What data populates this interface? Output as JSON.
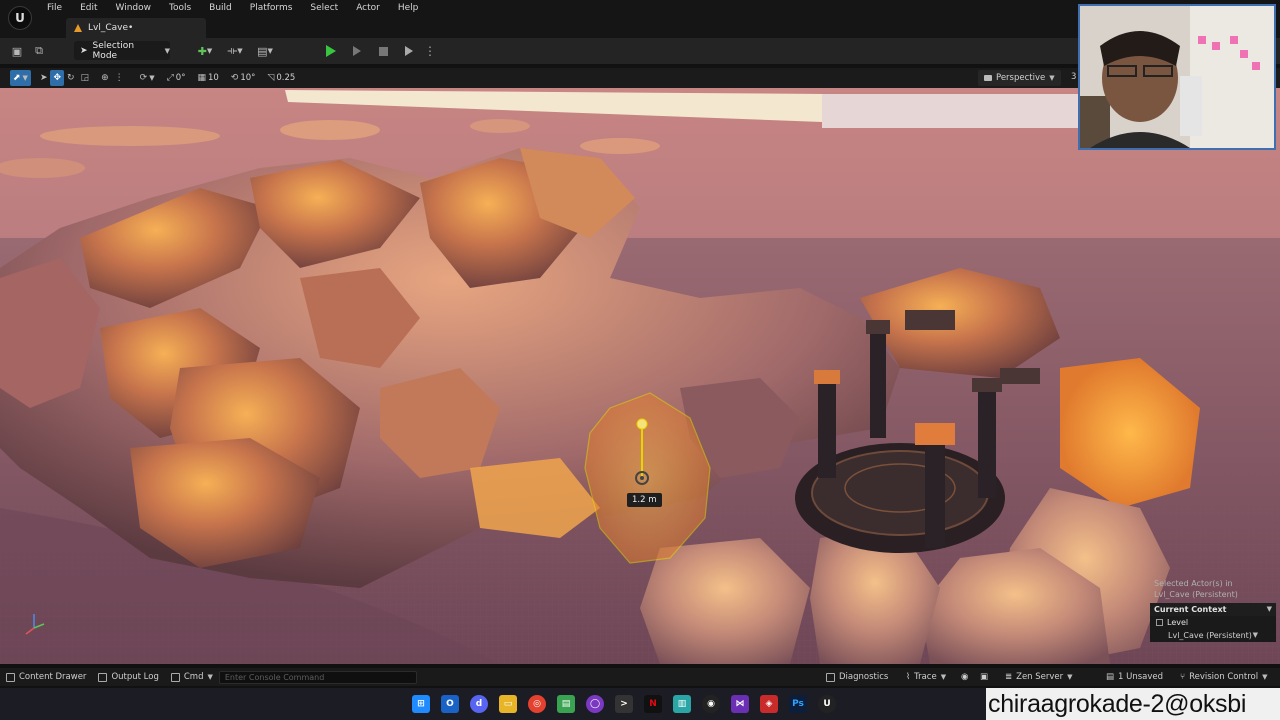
{
  "menu": {
    "items": [
      "File",
      "Edit",
      "Window",
      "Tools",
      "Build",
      "Platforms",
      "Select",
      "Actor",
      "Help"
    ]
  },
  "tab": {
    "label": "Lvl_Cave•"
  },
  "toolbar": {
    "selection_mode": "Selection Mode"
  },
  "viewport_toolbar": {
    "rot_snap": "0°",
    "grid_snap": "10",
    "angle_snap": "10°",
    "scale_snap": "0.25",
    "view_mode": "Perspective",
    "overflow": "3"
  },
  "viewport": {
    "measure_label": "1.2 m"
  },
  "selection_panel": {
    "line1": "Selected Actor(s) in",
    "line2": "Lvl_Cave (Persistent)",
    "context_header": "Current Context",
    "level_label": "Level",
    "level_value": "Lvl_Cave (Persistent)"
  },
  "statusbar": {
    "content_drawer": "Content Drawer",
    "output_log": "Output Log",
    "cmd": "Cmd",
    "console_placeholder": "Enter Console Command",
    "diagnostics": "Diagnostics",
    "trace": "Trace",
    "zen_server": "Zen Server",
    "unsaved": "1 Unsaved",
    "revision_control": "Revision Control"
  },
  "taskbar": {
    "apps": [
      "windows-start",
      "outlook",
      "discord",
      "file-explorer",
      "chrome",
      "notepad",
      "github",
      "terminal",
      "netflix",
      "files",
      "obs",
      "vscode",
      "davinci",
      "photoshop",
      "unreal"
    ]
  },
  "watermark": {
    "text": "chiraagrokade-2@oksbi"
  },
  "colors": {
    "accent_blue": "#2f6ea8",
    "play_green": "#39c540",
    "sand": "#8a5e6a",
    "rock_glow": "#f0a040",
    "selection_yellow": "#e8d400"
  }
}
